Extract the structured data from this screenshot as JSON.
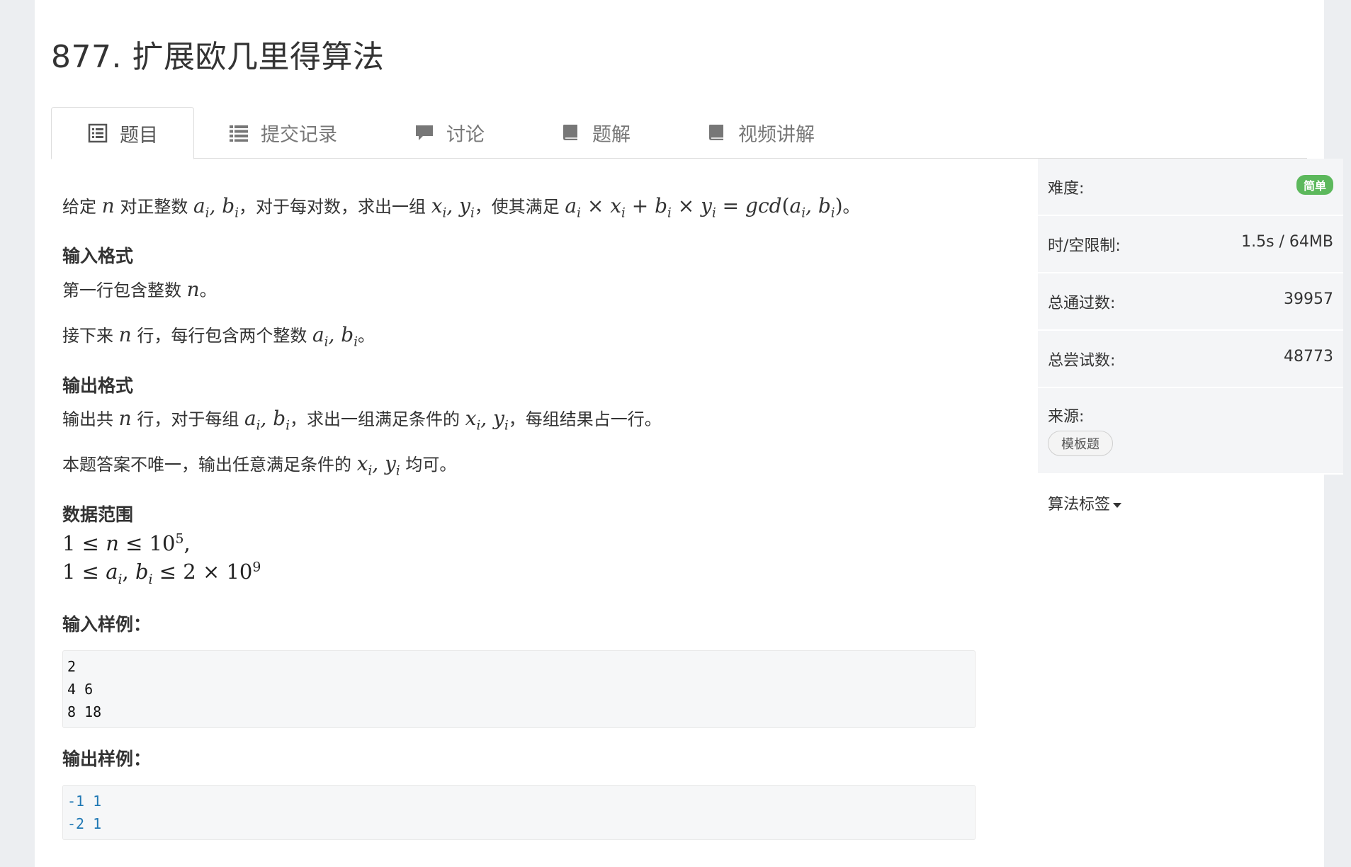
{
  "problem": {
    "title": "877. 扩展欧几里得算法"
  },
  "tabs": [
    {
      "label": "题目",
      "icon": "list-alt-icon"
    },
    {
      "label": "提交记录",
      "icon": "list-icon"
    },
    {
      "label": "讨论",
      "icon": "comment-icon"
    },
    {
      "label": "题解",
      "icon": "book-icon"
    },
    {
      "label": "视频讲解",
      "icon": "book-icon"
    }
  ],
  "statement": {
    "p1_a": "给定 ",
    "p1_b": " 对正整数 ",
    "p1_c": "，对于每对数，求出一组 ",
    "p1_d": "，使其满足 ",
    "p1_e": "。",
    "input_heading": "输入格式",
    "in_p1_a": "第一行包含整数 ",
    "in_p1_b": "。",
    "in_p2_a": "接下来 ",
    "in_p2_b": " 行，每行包含两个整数 ",
    "in_p2_c": "。",
    "output_heading": "输出格式",
    "out_p1_a": "输出共 ",
    "out_p1_b": " 行，对于每组 ",
    "out_p1_c": "，求出一组满足条件的 ",
    "out_p1_d": "，每组结果占一行。",
    "out_p2_a": "本题答案不唯一，输出任意满足条件的 ",
    "out_p2_b": " 均可。",
    "range_heading": "数据范围",
    "sample_in_heading": "输入样例：",
    "sample_out_heading": "输出样例："
  },
  "samples": {
    "input_lines": [
      "2",
      "4 6",
      "8 18"
    ],
    "output_lines": [
      "-1 1",
      "-2 1"
    ]
  },
  "sidebar": {
    "difficulty_label": "难度:",
    "difficulty_value": "简单",
    "limit_label": "时/空限制:",
    "limit_value": "1.5s / 64MB",
    "passed_label": "总通过数:",
    "passed_value": "39957",
    "tries_label": "总尝试数:",
    "tries_value": "48773",
    "source_label": "来源:",
    "source_tag": "模板题",
    "tags_label": "算法标签"
  },
  "colors": {
    "accent_green": "#5cb85c",
    "code_blue": "#1f78b4",
    "page_bg": "#eceef1"
  }
}
